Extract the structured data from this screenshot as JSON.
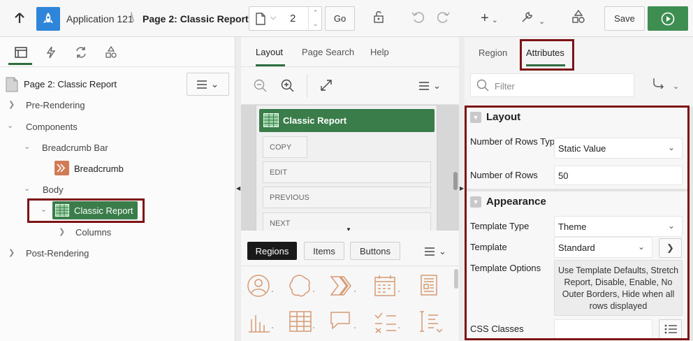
{
  "toolbar": {
    "app_name": "Application 121",
    "breadcrumb_separator": "\\",
    "page_name": "Page 2: Classic Report",
    "page_number": "2",
    "go_label": "Go",
    "save_label": "Save"
  },
  "left_panel": {
    "tabs": [
      "rendering-icon",
      "dynamic-actions-icon",
      "processing-icon",
      "shared-components-icon"
    ],
    "tree_root": "Page 2: Classic Report",
    "nodes": {
      "pre_rendering": "Pre-Rendering",
      "components": "Components",
      "breadcrumb_bar": "Breadcrumb Bar",
      "breadcrumb": "Breadcrumb",
      "body": "Body",
      "classic_report": "Classic Report",
      "columns": "Columns",
      "post_rendering": "Post-Rendering"
    }
  },
  "center_panel": {
    "tabs": {
      "layout": "Layout",
      "page_search": "Page Search",
      "help": "Help"
    },
    "layout_region": "Classic Report",
    "button_slots": [
      "COPY",
      "EDIT",
      "PREVIOUS",
      "NEXT"
    ],
    "gallery_tabs": {
      "regions": "Regions",
      "items": "Items",
      "buttons": "Buttons"
    }
  },
  "right_panel": {
    "tabs": {
      "region": "Region",
      "attributes": "Attributes"
    },
    "filter_placeholder": "Filter",
    "sections": {
      "layout": "Layout",
      "appearance": "Appearance"
    },
    "props": {
      "rows_type_label": "Number of Rows Type",
      "rows_type_value": "Static Value",
      "rows_label": "Number of Rows",
      "rows_value": "50",
      "template_type_label": "Template Type",
      "template_type_value": "Theme",
      "template_label": "Template",
      "template_value": "Standard",
      "template_options_label": "Template Options",
      "template_options_value": "Use Template Defaults, Stretch Report, Disable, Enable, No Outer Borders, Hide when all rows displayed",
      "css_classes_label": "CSS Classes",
      "css_classes_value": ""
    }
  },
  "colors": {
    "accent_green": "#3a7d4a",
    "highlight_red": "#7d1416",
    "app_blue": "#2e85d9"
  }
}
